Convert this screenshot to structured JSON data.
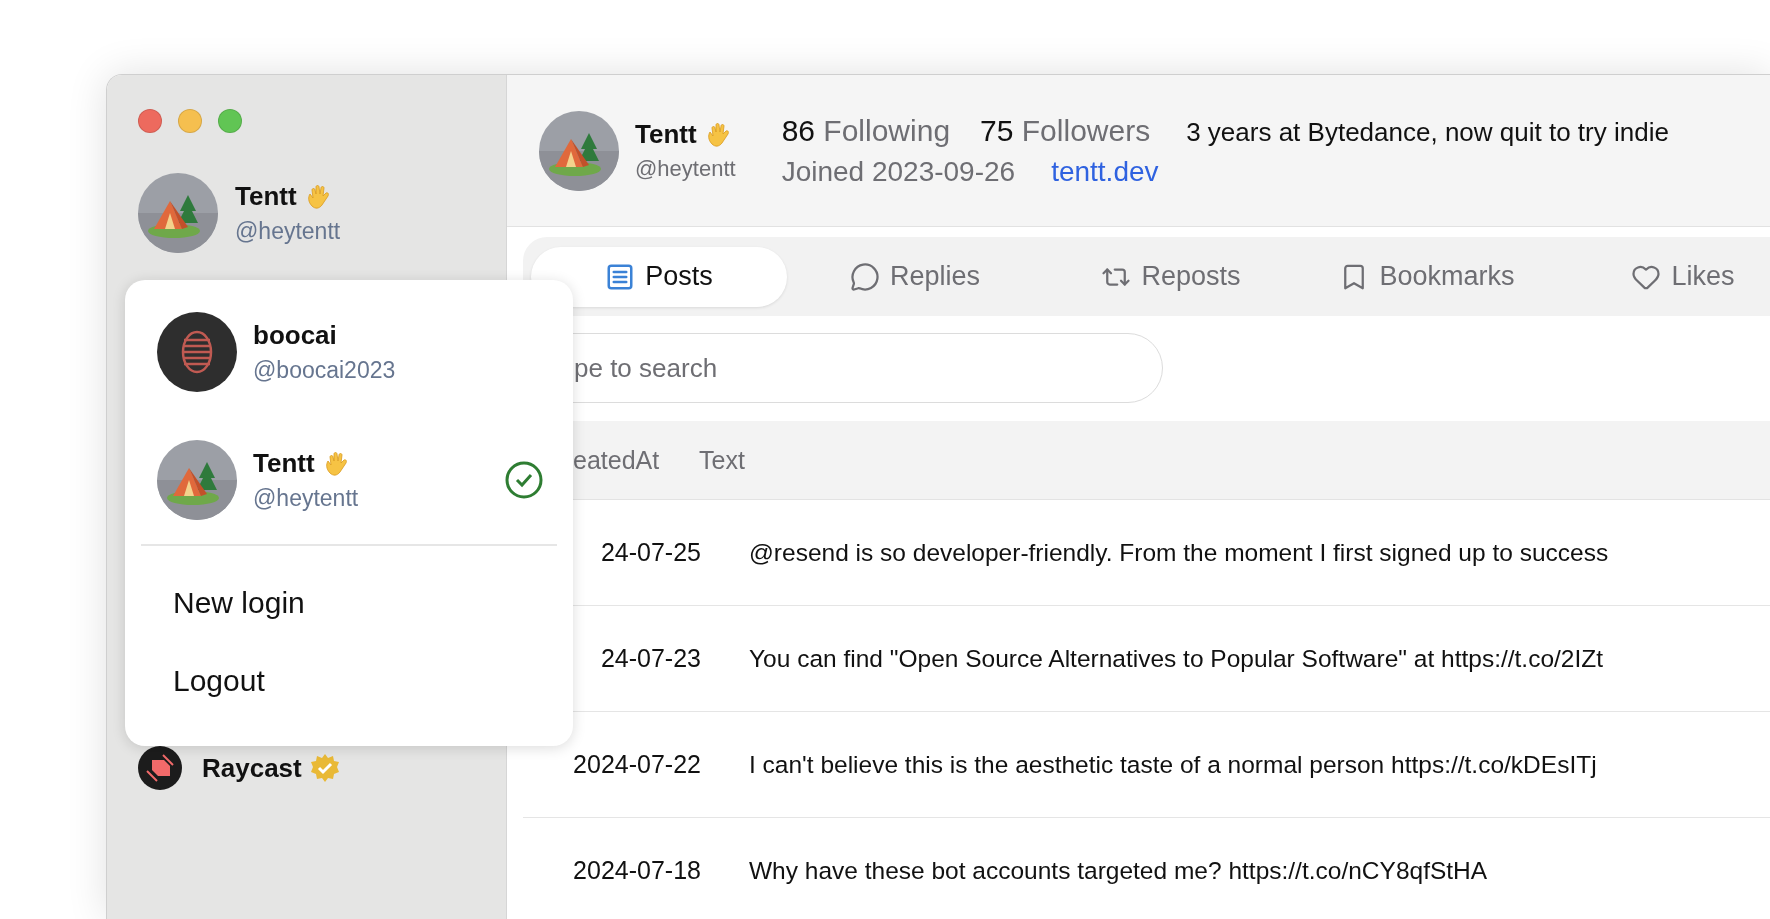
{
  "sidebar": {
    "profile": {
      "name": "Tentt",
      "waving": true,
      "handle": "@heytentt"
    },
    "items": [
      {
        "name": "Raycast",
        "verified": true
      }
    ]
  },
  "account_menu": {
    "accounts": [
      {
        "name": "boocai",
        "waving": false,
        "handle": "@boocai2023",
        "selected": false
      },
      {
        "name": "Tentt",
        "waving": true,
        "handle": "@heytentt",
        "selected": true
      }
    ],
    "actions": [
      "New login",
      "Logout"
    ]
  },
  "profile": {
    "name": "Tentt",
    "waving": true,
    "handle": "@heytentt",
    "following_count": "86",
    "following_label": "Following",
    "followers_count": "75",
    "followers_label": "Followers",
    "joined": "Joined 2023-09-26",
    "website": "tentt.dev",
    "bio": "3 years at Bytedance, now quit to try indie"
  },
  "tabs": [
    {
      "label": "Posts",
      "selected": true
    },
    {
      "label": "Replies",
      "selected": false
    },
    {
      "label": "Reposts",
      "selected": false
    },
    {
      "label": "Bookmarks",
      "selected": false
    },
    {
      "label": "Likes",
      "selected": false
    }
  ],
  "search": {
    "placeholder": "pe to search"
  },
  "table": {
    "columns": [
      "eatedAt",
      "Text"
    ],
    "rows": [
      [
        "24-07-25",
        "@resend is so developer-friendly. From the moment I first signed up to success"
      ],
      [
        "24-07-23",
        "You can find \"Open Source Alternatives to Popular Software\" at https://t.co/2IZt"
      ],
      [
        "2024-07-22",
        "I can't believe this is the aesthetic taste of a normal person https://t.co/kDEsITj"
      ],
      [
        "2024-07-18",
        "Why have these bot accounts targeted me? https://t.co/nCY8qfStHA"
      ]
    ]
  }
}
